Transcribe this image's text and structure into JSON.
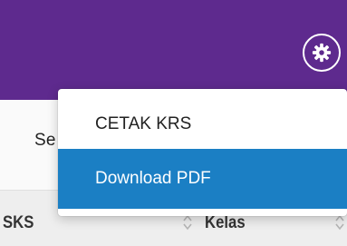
{
  "header": {
    "background_color": "#5e2a8e",
    "settings_icon": "gear-icon"
  },
  "content": {
    "partial_label": "Se"
  },
  "dropdown": {
    "items": [
      {
        "label": "CETAK KRS",
        "highlighted": false
      },
      {
        "label": "Download PDF",
        "highlighted": true
      }
    ],
    "highlight_color": "#1b7fc4"
  },
  "table": {
    "columns": [
      {
        "label": "SKS",
        "sort_icon": "sort-icon"
      },
      {
        "label": "Kelas",
        "sort_icon": "sort-icon"
      }
    ]
  }
}
